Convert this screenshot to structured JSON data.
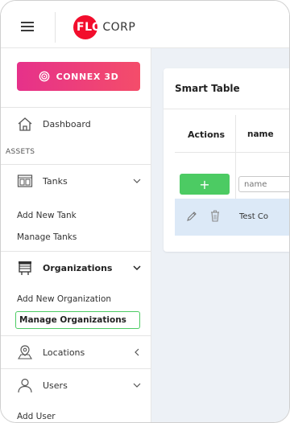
{
  "header": {
    "logo_flo": "FLO",
    "logo_corp": "CORP",
    "logo_color": "#f20d2c"
  },
  "sidebar": {
    "connex_button": "CONNEX 3D",
    "dashboard": "Dashboard",
    "section_assets": "ASSETS",
    "tanks": "Tanks",
    "tanks_sub": [
      "Add New Tank",
      "Manage Tanks"
    ],
    "organizations": "Organizations",
    "organizations_sub": [
      "Add New Organization",
      "Manage Organizations"
    ],
    "locations": "Locations",
    "users": "Users",
    "users_sub": [
      "Add User"
    ],
    "active_item": "Manage Organizations",
    "accent_color": "#4ccb63",
    "connex_gradient": [
      "#e6318a",
      "#f44d6a"
    ]
  },
  "table": {
    "title": "Smart Table",
    "columns": [
      "Actions",
      "name"
    ],
    "add_button": "+",
    "filter_placeholder": "name",
    "rows": [
      {
        "name": "Test Co"
      }
    ]
  }
}
